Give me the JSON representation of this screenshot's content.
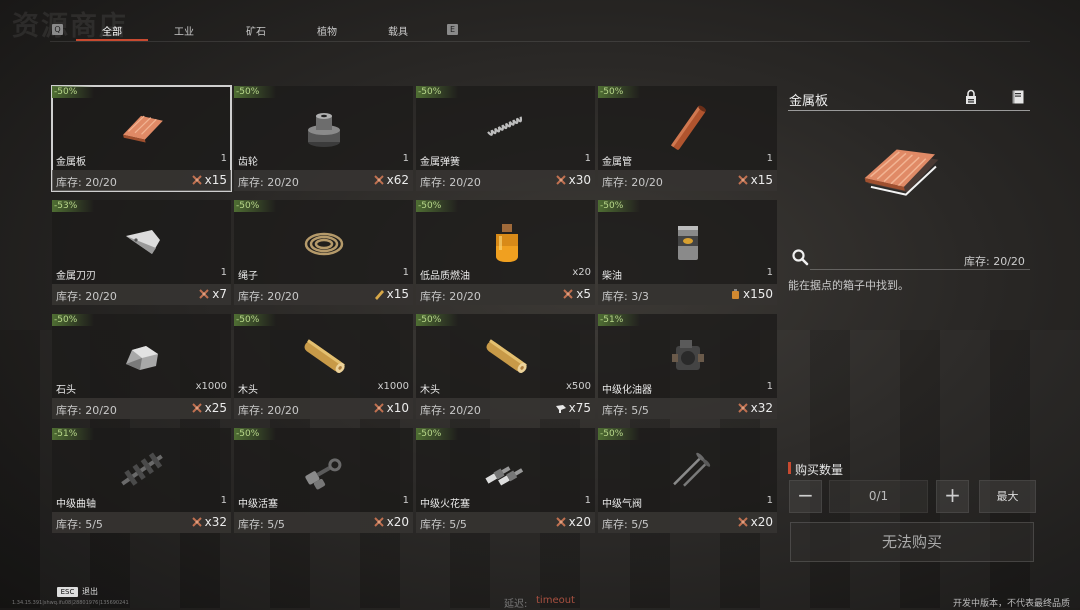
{
  "page_title": "资源商店",
  "tabs": {
    "key_left": "Q",
    "key_right": "E",
    "items": [
      {
        "label": "全部",
        "active": true
      },
      {
        "label": "工业",
        "active": false
      },
      {
        "label": "矿石",
        "active": false
      },
      {
        "label": "植物",
        "active": false
      },
      {
        "label": "载具",
        "active": false
      }
    ]
  },
  "colors": {
    "accent": "#c84a30",
    "discount_green": "#4f6e33",
    "latency_red": "#a85040"
  },
  "items": [
    {
      "discount": "-50%",
      "name": "金属板",
      "qty": "1",
      "stock": "库存: 20/20",
      "cost_icon": "crossed-tools-icon",
      "cost": "x15",
      "icon": "metal-sheet-icon",
      "selected": true
    },
    {
      "discount": "-50%",
      "name": "齿轮",
      "qty": "1",
      "stock": "库存: 20/20",
      "cost_icon": "crossed-tools-icon",
      "cost": "x62",
      "icon": "gear-item-icon"
    },
    {
      "discount": "-50%",
      "name": "金属弹簧",
      "qty": "1",
      "stock": "库存: 20/20",
      "cost_icon": "crossed-tools-icon",
      "cost": "x30",
      "icon": "spring-icon"
    },
    {
      "discount": "-50%",
      "name": "金属管",
      "qty": "1",
      "stock": "库存: 20/20",
      "cost_icon": "crossed-tools-icon",
      "cost": "x15",
      "icon": "metal-pipe-icon"
    },
    {
      "discount": "-53%",
      "name": "金属刀刃",
      "qty": "1",
      "stock": "库存: 20/20",
      "cost_icon": "crossed-tools-icon",
      "cost": "x7",
      "icon": "blade-icon"
    },
    {
      "discount": "-50%",
      "name": "绳子",
      "qty": "1",
      "stock": "库存: 20/20",
      "cost_icon": "wood-plank-icon",
      "cost": "x15",
      "icon": "rope-icon"
    },
    {
      "discount": "-50%",
      "name": "低品质燃油",
      "qty": "x20",
      "stock": "库存: 20/20",
      "cost_icon": "crossed-tools-icon",
      "cost": "x5",
      "icon": "fuel-bottle-icon"
    },
    {
      "discount": "-50%",
      "name": "柴油",
      "qty": "1",
      "stock": "库存: 3/3",
      "cost_icon": "fuel-can-icon",
      "cost": "x150",
      "icon": "diesel-barrel-icon"
    },
    {
      "discount": "-50%",
      "name": "石头",
      "qty": "x1000",
      "stock": "库存: 20/20",
      "cost_icon": "crossed-tools-icon",
      "cost": "x25",
      "icon": "stone-icon"
    },
    {
      "discount": "-50%",
      "name": "木头",
      "qty": "x1000",
      "stock": "库存: 20/20",
      "cost_icon": "crossed-tools-icon",
      "cost": "x10",
      "icon": "log-icon"
    },
    {
      "discount": "-50%",
      "name": "木头",
      "qty": "x500",
      "stock": "库存: 20/20",
      "cost_icon": "white-item-icon",
      "cost": "x75",
      "icon": "log-icon"
    },
    {
      "discount": "-51%",
      "name": "中级化油器",
      "qty": "1",
      "stock": "库存: 5/5",
      "cost_icon": "crossed-tools-icon",
      "cost": "x32",
      "icon": "carburetor-icon"
    },
    {
      "discount": "-51%",
      "name": "中级曲轴",
      "qty": "1",
      "stock": "库存: 5/5",
      "cost_icon": "crossed-tools-icon",
      "cost": "x32",
      "icon": "crankshaft-icon"
    },
    {
      "discount": "-50%",
      "name": "中级活塞",
      "qty": "1",
      "stock": "库存: 5/5",
      "cost_icon": "crossed-tools-icon",
      "cost": "x20",
      "icon": "piston-icon"
    },
    {
      "discount": "-50%",
      "name": "中级火花塞",
      "qty": "1",
      "stock": "库存: 5/5",
      "cost_icon": "crossed-tools-icon",
      "cost": "x20",
      "icon": "spark-plug-icon"
    },
    {
      "discount": "-50%",
      "name": "中级气阀",
      "qty": "1",
      "stock": "库存: 5/5",
      "cost_icon": "crossed-tools-icon",
      "cost": "x20",
      "icon": "valve-icon"
    }
  ],
  "detail": {
    "title": "金属板",
    "lock_icon": "lock-icon",
    "book_icon": "book-icon",
    "image_icon": "metal-sheet-icon",
    "search_icon": "search-icon",
    "stock": "库存: 20/20",
    "description": "能在据点的箱子中找到。"
  },
  "purchase": {
    "label": "购买数量",
    "minus": "−",
    "value": "0/1",
    "plus": "+",
    "max": "最大",
    "buy_button": "无法购买"
  },
  "footer": {
    "esc_key": "ESC",
    "esc_label": "退出",
    "version": "1.34.15.39​1|shwq.ifu08|28801976|135690241",
    "latency_label": "延迟:",
    "latency_value": "timeout",
    "dev_notice": "开发中版本，不代表最终品质"
  }
}
